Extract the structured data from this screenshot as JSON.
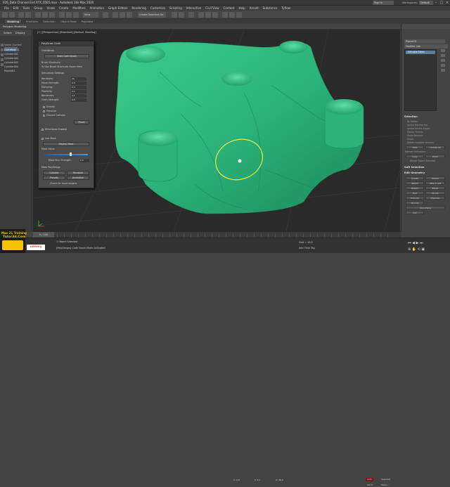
{
  "title": "026_Data Channel End XYX_0505.max - Autodesk 3ds Max 2020",
  "signin": "Sign In",
  "workspaces_label": "Workspaces:",
  "workspaces_value": "Default",
  "menu": [
    "File",
    "Edit",
    "Tools",
    "Group",
    "Views",
    "Create",
    "Modifiers",
    "Animation",
    "Graph Editors",
    "Rendering",
    "Customize",
    "Scripting",
    "Interactive",
    "Civil View",
    "Content",
    "Help",
    "Arnold",
    "Substance",
    "Tyflow"
  ],
  "toolbar": {
    "view": "View",
    "select_set": "Create Selection Se"
  },
  "ribbon": [
    "Modeling",
    "Freeform",
    "Selection",
    "Object Paint",
    "Populate"
  ],
  "ribbon_active": "Modeling",
  "polygon_modeling": "Polygon Modeling",
  "left_panel": {
    "tabs": [
      "Select",
      "Display"
    ],
    "header": "Name (Sorted Ascending)",
    "rows": [
      "ClothMesh",
      "Cylinder001",
      "Cylinder002",
      "Cylinder003",
      "Cylinder004",
      "Plane001"
    ],
    "selected_row": "ClothMesh"
  },
  "viewport_label": "[+] [Perspective] [Standard] [Default Shading]",
  "dialog": {
    "title": "PolyDraw Cloth",
    "section": "ClothBrush",
    "start_button": "Start Cloth Brush",
    "shortcuts_title": "Brush Shortcuts:",
    "shortcuts_text": "To Use Brush Shortcuts Hover Here",
    "sim_title": "Simulation Settings",
    "params": [
      {
        "label": "Iterations:",
        "value": "20"
      },
      {
        "label": "Move Strength:",
        "value": "0.3"
      },
      {
        "label": "Damping:",
        "value": "0.3"
      },
      {
        "label": "Plasticity:",
        "value": "0.1"
      },
      {
        "label": "Bendiness:",
        "value": "0.1"
      },
      {
        "label": "Cloth Strength:",
        "value": "0.5"
      }
    ],
    "checks": [
      "Gravity",
      "Pressure",
      "Ground Collision"
    ],
    "reset_button": "Reset",
    "directional": "Directional Expand",
    "use_mask": "Use Mask",
    "display_mask": "Display Mask",
    "mask_value_label": "Mask Value",
    "mask_value": 0.6,
    "blur_label": "Mask Blur Strength:",
    "blur_value": "0.5",
    "more_title": "More PolyDesign",
    "more_buttons": [
      "Cylinder",
      "Parabolic",
      "Presets",
      "Animation"
    ],
    "more_link": "Check for more plugins"
  },
  "mod_panel": {
    "object_name": "Plane001",
    "modifier_list": "Modifier List",
    "stack_item": "Editable Mesh",
    "selection_title": "Selection",
    "by_vertex": "By Vertex",
    "ignore_backfacing": "Ignore Backfacing",
    "ignore_visible": "Ignore Visible Edges",
    "planar_thresh": "Planar Thresh:",
    "show_normals": "Show Normals",
    "scale": "Scale:",
    "delete_isolated": "Delete Isolated Vertices",
    "hide": "Hide",
    "unhide_all": "Unhide All",
    "named_selections": "Named Selections:",
    "copy": "Copy",
    "paste": "Paste",
    "whole_object": "Whole Object Selected",
    "soft_selection": "Soft Selection",
    "edit_geometry": "Edit Geometry",
    "create": "Create",
    "delete": "Delete",
    "attach": "Attach",
    "attach_list": "Attach List",
    "detach": "Detach",
    "break": "Break",
    "turn": "Turn",
    "divide": "Divide",
    "extrude": "Extrude",
    "chamfer": "Chamfer",
    "normal": "Normal",
    "slice_plane": "Slice Plane",
    "cut": "Cut"
  },
  "status": {
    "selected": "1 Object Selected",
    "prompt": "[PolyDesign] Cloth Brush Mode Activated",
    "maxscript": "Max 21 Training",
    "frame": "0 / 100",
    "x": "X: 0.0",
    "y": "Y: 0.0",
    "z": "Z: 36.0",
    "grid": "Grid = 10.0",
    "add_time_tag": "Add Time Tag",
    "auto": "Auto",
    "set_key": "Set K.",
    "selected_key": "Selected",
    "filters": "Filters..."
  },
  "logo": {
    "line1": "Max 21 Training",
    "line2": "Tutor3d.Com"
  },
  "udemy": "udemy",
  "colors": {
    "cloth": "#2bb37a",
    "viewport_bg": "#2a2a2a",
    "ui_panel": "#444444",
    "selection_blue": "#4f6c8a",
    "brush_circle": "#e8f040"
  }
}
